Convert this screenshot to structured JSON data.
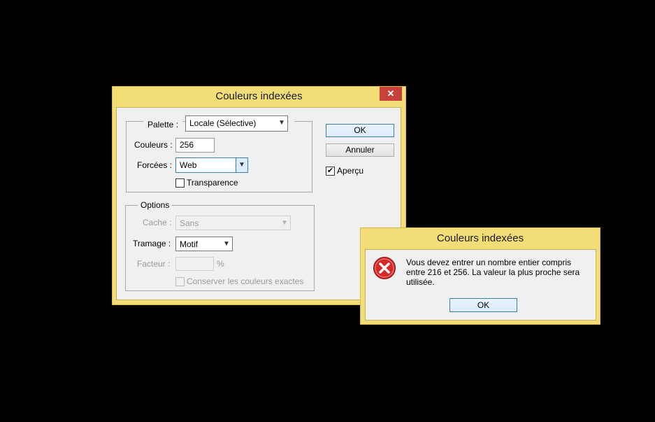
{
  "main_dialog": {
    "title": "Couleurs indexées",
    "close_glyph": "✕",
    "palette": {
      "label": "Palette :",
      "value": "Locale (Sélective)"
    },
    "couleurs": {
      "label": "Couleurs :",
      "value": "256"
    },
    "forcees": {
      "label": "Forcées :",
      "value": "Web"
    },
    "transparence": {
      "label": "Transparence",
      "checked": false
    },
    "ok_label": "OK",
    "cancel_label": "Annuler",
    "apercu": {
      "label": "Aperçu",
      "checked": true
    },
    "options": {
      "legend": "Options",
      "cache": {
        "label": "Cache :",
        "value": "Sans"
      },
      "tramage": {
        "label": "Tramage :",
        "value": "Motif"
      },
      "facteur": {
        "label": "Facteur :",
        "value": "",
        "unit": "%"
      },
      "conserver": {
        "label": "Conserver les couleurs exactes",
        "checked": false
      }
    }
  },
  "alert_dialog": {
    "title": "Couleurs indexées",
    "message_line1": "Vous devez entrer un nombre entier compris",
    "message_line2": "entre 216 et 256. La valeur la plus proche sera",
    "message_line3": "utilisée.",
    "icon": "error-icon",
    "ok_label": "OK"
  },
  "colors": {
    "frame": "#f3dd77",
    "close_button": "#c7403a",
    "accent": "#3c7fb1"
  }
}
